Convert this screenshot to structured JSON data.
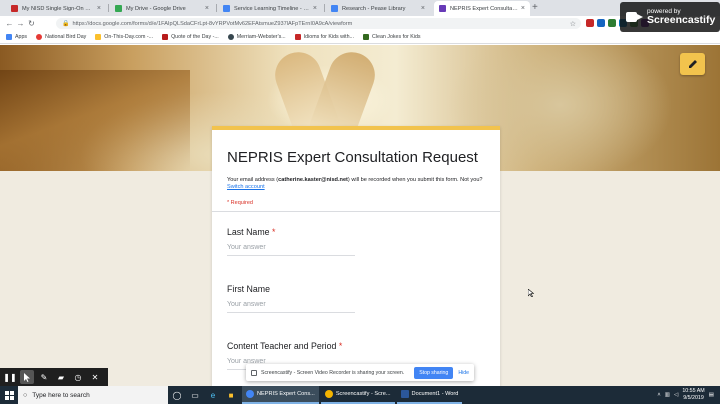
{
  "browser": {
    "tabs": [
      {
        "label": "My NISD Single Sign-On Portal",
        "color": "#c62828"
      },
      {
        "label": "My Drive - Google Drive",
        "color": "#34a853"
      },
      {
        "label": "Service Learning Timeline - Goo",
        "color": "#4285f4"
      },
      {
        "label": "Research - Pease Library",
        "color": "#4285f4"
      },
      {
        "label": "NEPRIS Expert Consultation Requ",
        "color": "#673ab7"
      }
    ],
    "url": "https://docs.google.com/forms/d/e/1FAIpQLSdaCFrLpt-8vYRPVotMv62EFAtsmueZ937lAFpTErnI0A9cA/viewform",
    "bookmarks": [
      {
        "label": "Apps",
        "color": "#4285f4"
      },
      {
        "label": "National Bird Day",
        "color": "#e53935"
      },
      {
        "label": "On-This-Day.com -...",
        "color": "#fbc02d"
      },
      {
        "label": "Quote of the Day -...",
        "color": "#b71c1c"
      },
      {
        "label": "Merriam-Webster's...",
        "color": "#37474f"
      },
      {
        "label": "Idioms for Kids with...",
        "color": "#c62828"
      },
      {
        "label": "Clean Jokes for Kids",
        "color": "#33691e"
      }
    ]
  },
  "watermark": {
    "small": "powered by",
    "big": "Screencastify"
  },
  "form": {
    "title": "NEPRIS Expert Consultation Request",
    "desc_prefix": "Your email address (",
    "email": "catherine.kaster@nisd.net",
    "desc_suffix": ") will be recorded when you submit this form. Not you?",
    "switch_account": "Switch account",
    "required_note": "* Required",
    "accent": "#f2c34d",
    "questions": [
      {
        "label": "Last Name",
        "required": "*",
        "placeholder": "Your answer"
      },
      {
        "label": "First Name",
        "required": "",
        "placeholder": "Your answer"
      },
      {
        "label": "Content Teacher and Period",
        "required": "*",
        "placeholder": "Your answer"
      }
    ]
  },
  "share_bar": {
    "text": "Screencastify - Screen Video Recorder is sharing your screen.",
    "stop_label": "Stop sharing",
    "hide_label": "Hide"
  },
  "annotation_tools": [
    "pause-icon",
    "pointer-icon",
    "pen-icon",
    "highlighter-icon",
    "timer-icon",
    "close-icon"
  ],
  "taskbar": {
    "search_placeholder": "Type here to search",
    "apps": [
      {
        "label": "NEPRIS Expert Cons...",
        "color": "#4285f4"
      },
      {
        "label": "Screencastify - Scre...",
        "color": "#f4b400"
      },
      {
        "label": "Document1 - Word",
        "color": "#2b579a"
      }
    ],
    "time": "10:55 AM",
    "date": "9/5/2019"
  }
}
